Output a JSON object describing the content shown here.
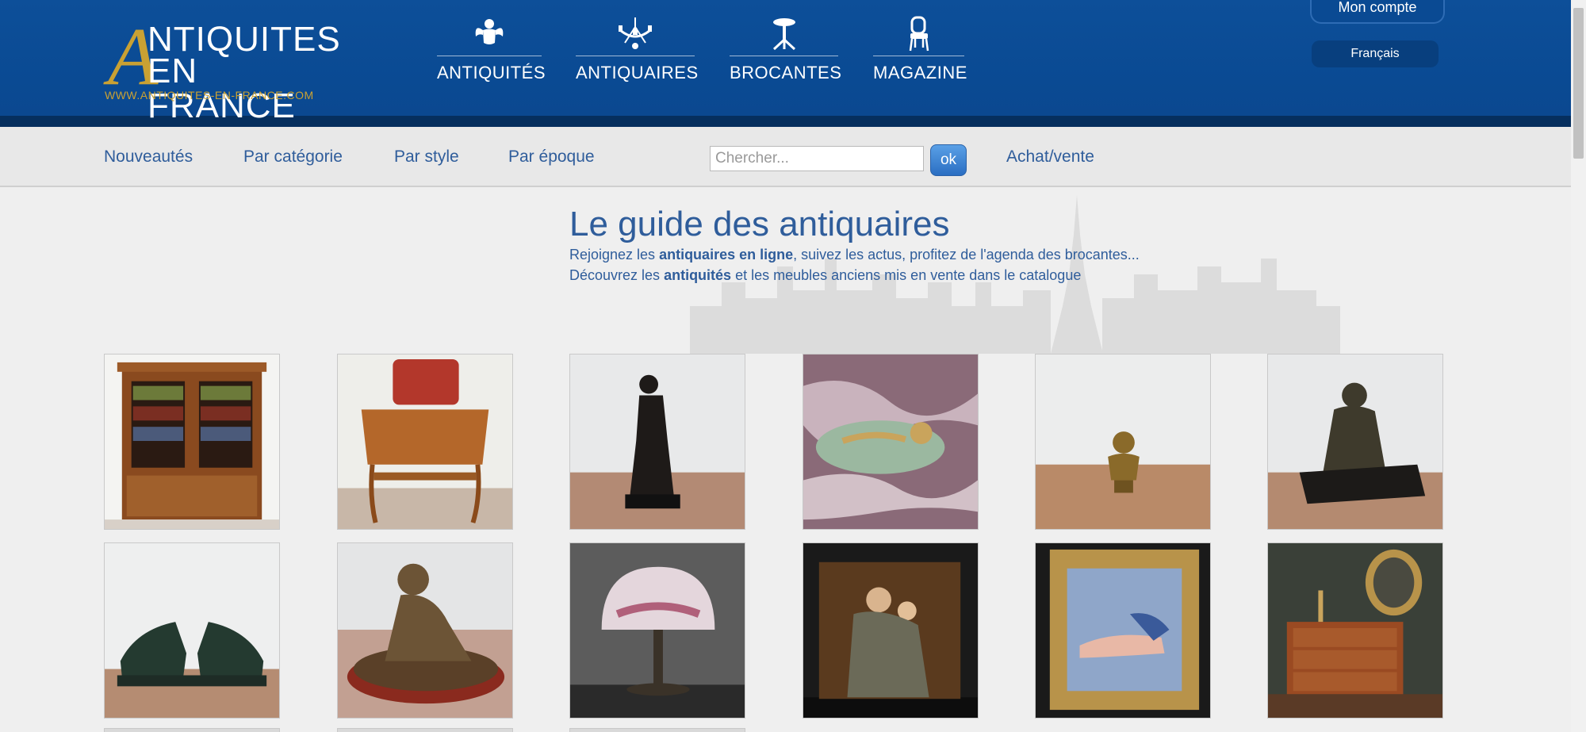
{
  "brand": {
    "logo_letter": "A",
    "line1": "NTIQUITES",
    "line2": "EN FRANCE",
    "url": "WWW.ANTIQUITES-EN-FRANCE.COM"
  },
  "main_nav": [
    {
      "label": "ANTIQUITÉS",
      "icon": "cherub-icon"
    },
    {
      "label": "ANTIQUAIRES",
      "icon": "chandelier-icon"
    },
    {
      "label": "BROCANTES",
      "icon": "table-icon"
    },
    {
      "label": "MAGAZINE",
      "icon": "chair-icon"
    }
  ],
  "account_label": "Mon compte",
  "language_label": "Français",
  "sub_nav": {
    "links": [
      "Nouveautés",
      "Par catégorie",
      "Par style",
      "Par époque"
    ],
    "search_placeholder": "Chercher...",
    "search_button": "ok",
    "buy_sell": "Achat/vente"
  },
  "guide": {
    "title": "Le guide des antiquaires",
    "line1_pre": "Rejoignez les ",
    "line1_bold": "antiquaires en ligne",
    "line1_post": ", suivez les actus, profitez de l'agenda des brocantes...",
    "line2_pre": "Découvrez les ",
    "line2_bold": "antiquités",
    "line2_post": " et les meubles anciens mis en vente dans le catalogue"
  },
  "colors": {
    "header_blue": "#0d4f99",
    "header_dark": "#062f5e",
    "gold": "#c9a133",
    "link_blue": "#2f5d9b"
  },
  "gallery": [
    {
      "subject": "bookcase"
    },
    {
      "subject": "writing-table"
    },
    {
      "subject": "venus-statue"
    },
    {
      "subject": "onyx-tray"
    },
    {
      "subject": "bronze-bust"
    },
    {
      "subject": "bronze-faun"
    },
    {
      "subject": "panther-bookends"
    },
    {
      "subject": "bronze-child"
    },
    {
      "subject": "art-nouveau-lamp"
    },
    {
      "subject": "madonna-painting"
    },
    {
      "subject": "framed-nude"
    },
    {
      "subject": "louis-xvi-commode"
    }
  ]
}
